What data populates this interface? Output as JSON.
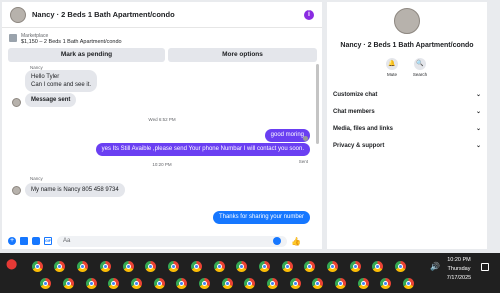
{
  "chat": {
    "title": "Nancy · 2 Beds 1 Bath Apartment/condo",
    "marketplace_label": "Marketplace",
    "listing": "$1,150 – 2 Beds 1 Bath Apartment/condo",
    "mark_pending_label": "Mark as pending",
    "more_options_label": "More options"
  },
  "messages": {
    "sender_1": "Nancy",
    "msg_1a": "Hello Tyler",
    "msg_1b": "Can I come and see it.",
    "msg_2": "Message sent",
    "time_1": "Wed 6:52 PM",
    "msg_out_1": "good moring",
    "msg_out_2": "yes Its Still Avaible ,please send Your phone Numbar I will contact you soon.",
    "time_2": "10:20 PM",
    "sender_2": "Nancy",
    "msg_3": "My name is Nancy 805 458 9734",
    "msg_out_3": "Thanks for sharing your number",
    "sent_status": "Sent"
  },
  "composer": {
    "placeholder": "Aa"
  },
  "info_panel": {
    "name": "Nancy · 2 Beds 1 Bath Apartment/condo",
    "mute_label": "Mute",
    "search_label": "Search",
    "sections": [
      "Customize chat",
      "Chat members",
      "Media, files and links",
      "Privacy & support"
    ]
  },
  "taskbar": {
    "time": "10:20 PM",
    "day": "Thursday",
    "date": "7/17/2025"
  },
  "colors": {
    "outgoing_bubble": "#6a3ff2",
    "last_bubble": "#1677ff",
    "info_icon": "#8a2be2"
  }
}
